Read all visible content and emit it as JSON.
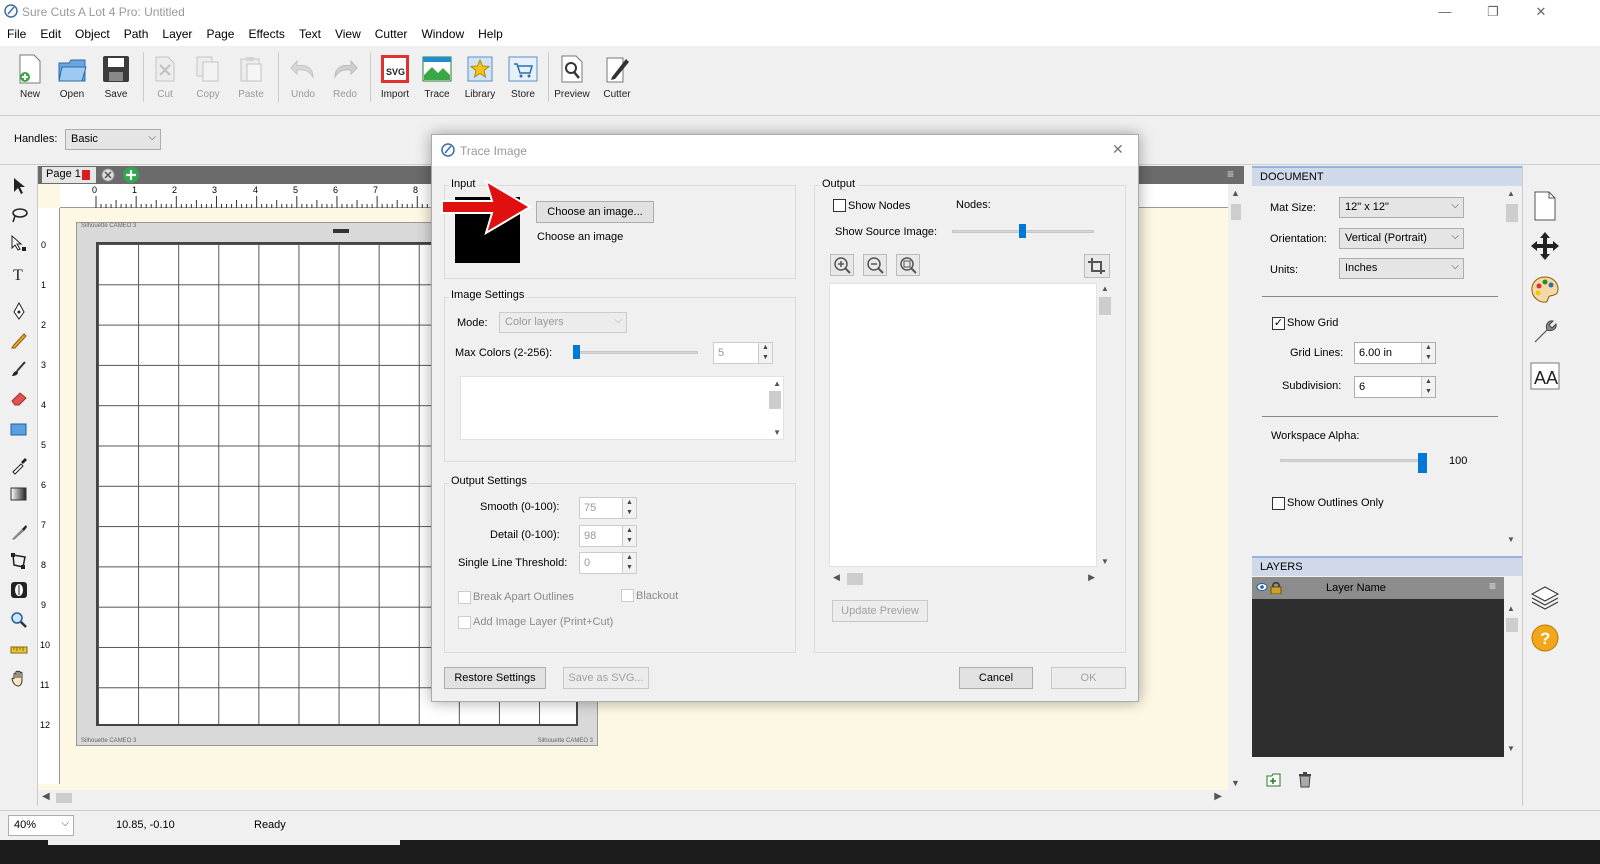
{
  "window": {
    "title": "Sure Cuts A Lot 4 Pro: Untitled",
    "minimize": "—",
    "maximize": "❐",
    "close": "✕"
  },
  "menu": [
    "File",
    "Edit",
    "Object",
    "Path",
    "Layer",
    "Page",
    "Effects",
    "Text",
    "View",
    "Cutter",
    "Window",
    "Help"
  ],
  "toolbar": {
    "new": "New",
    "open": "Open",
    "save": "Save",
    "cut": "Cut",
    "copy": "Copy",
    "paste": "Paste",
    "undo": "Undo",
    "redo": "Redo",
    "import": "Import",
    "trace": "Trace",
    "library": "Library",
    "store": "Store",
    "preview": "Preview",
    "cutter": "Cutter"
  },
  "handles": {
    "label": "Handles:",
    "value": "Basic"
  },
  "page_tab": {
    "label": "Page 1"
  },
  "ruler_top": [
    "0",
    "1",
    "2",
    "3",
    "4",
    "5",
    "6",
    "7",
    "8"
  ],
  "ruler_left": [
    "0",
    "1",
    "2",
    "3",
    "4",
    "5",
    "6",
    "7",
    "8",
    "9",
    "10",
    "11",
    "12"
  ],
  "mat": {
    "label_top": "Silhouette CAMEO 3",
    "label_bl": "Silhouette CAMEO 3",
    "label_br": "Silhouette CAMEO 3"
  },
  "dialog": {
    "title": "Trace Image",
    "input": {
      "heading": "Input",
      "choose_button": "Choose an image...",
      "caption": "Choose an image"
    },
    "image_settings": {
      "heading": "Image Settings",
      "mode_label": "Mode:",
      "mode_value": "Color layers",
      "max_colors_label": "Max Colors (2-256):",
      "max_colors_value": "5"
    },
    "output_settings": {
      "heading": "Output Settings",
      "smooth_label": "Smooth (0-100):",
      "smooth_value": "75",
      "detail_label": "Detail (0-100):",
      "detail_value": "98",
      "threshold_label": "Single Line Threshold:",
      "threshold_value": "0",
      "break_apart": "Break Apart Outlines",
      "blackout": "Blackout",
      "add_image_layer": "Add Image Layer (Print+Cut)"
    },
    "output": {
      "heading": "Output",
      "show_nodes": "Show Nodes",
      "nodes_label": "Nodes:",
      "show_source_label": "Show Source Image:",
      "update_preview": "Update Preview"
    },
    "buttons": {
      "restore": "Restore Settings",
      "save_svg": "Save as SVG...",
      "cancel": "Cancel",
      "ok": "OK"
    }
  },
  "document_panel": {
    "heading": "DOCUMENT",
    "mat_size_label": "Mat Size:",
    "mat_size_value": "12\" x 12\"",
    "orientation_label": "Orientation:",
    "orientation_value": "Vertical (Portrait)",
    "units_label": "Units:",
    "units_value": "Inches",
    "show_grid": "Show Grid",
    "grid_lines_label": "Grid Lines:",
    "grid_lines_value": "6.00 in",
    "subdivision_label": "Subdivision:",
    "subdivision_value": "6",
    "workspace_alpha_label": "Workspace Alpha:",
    "workspace_alpha_value": "100",
    "show_outlines_only": "Show Outlines Only"
  },
  "layers_panel": {
    "heading": "LAYERS",
    "column_name": "Layer Name"
  },
  "status": {
    "zoom": "40%",
    "coords": "10.85, -0.10",
    "state": "Ready"
  }
}
